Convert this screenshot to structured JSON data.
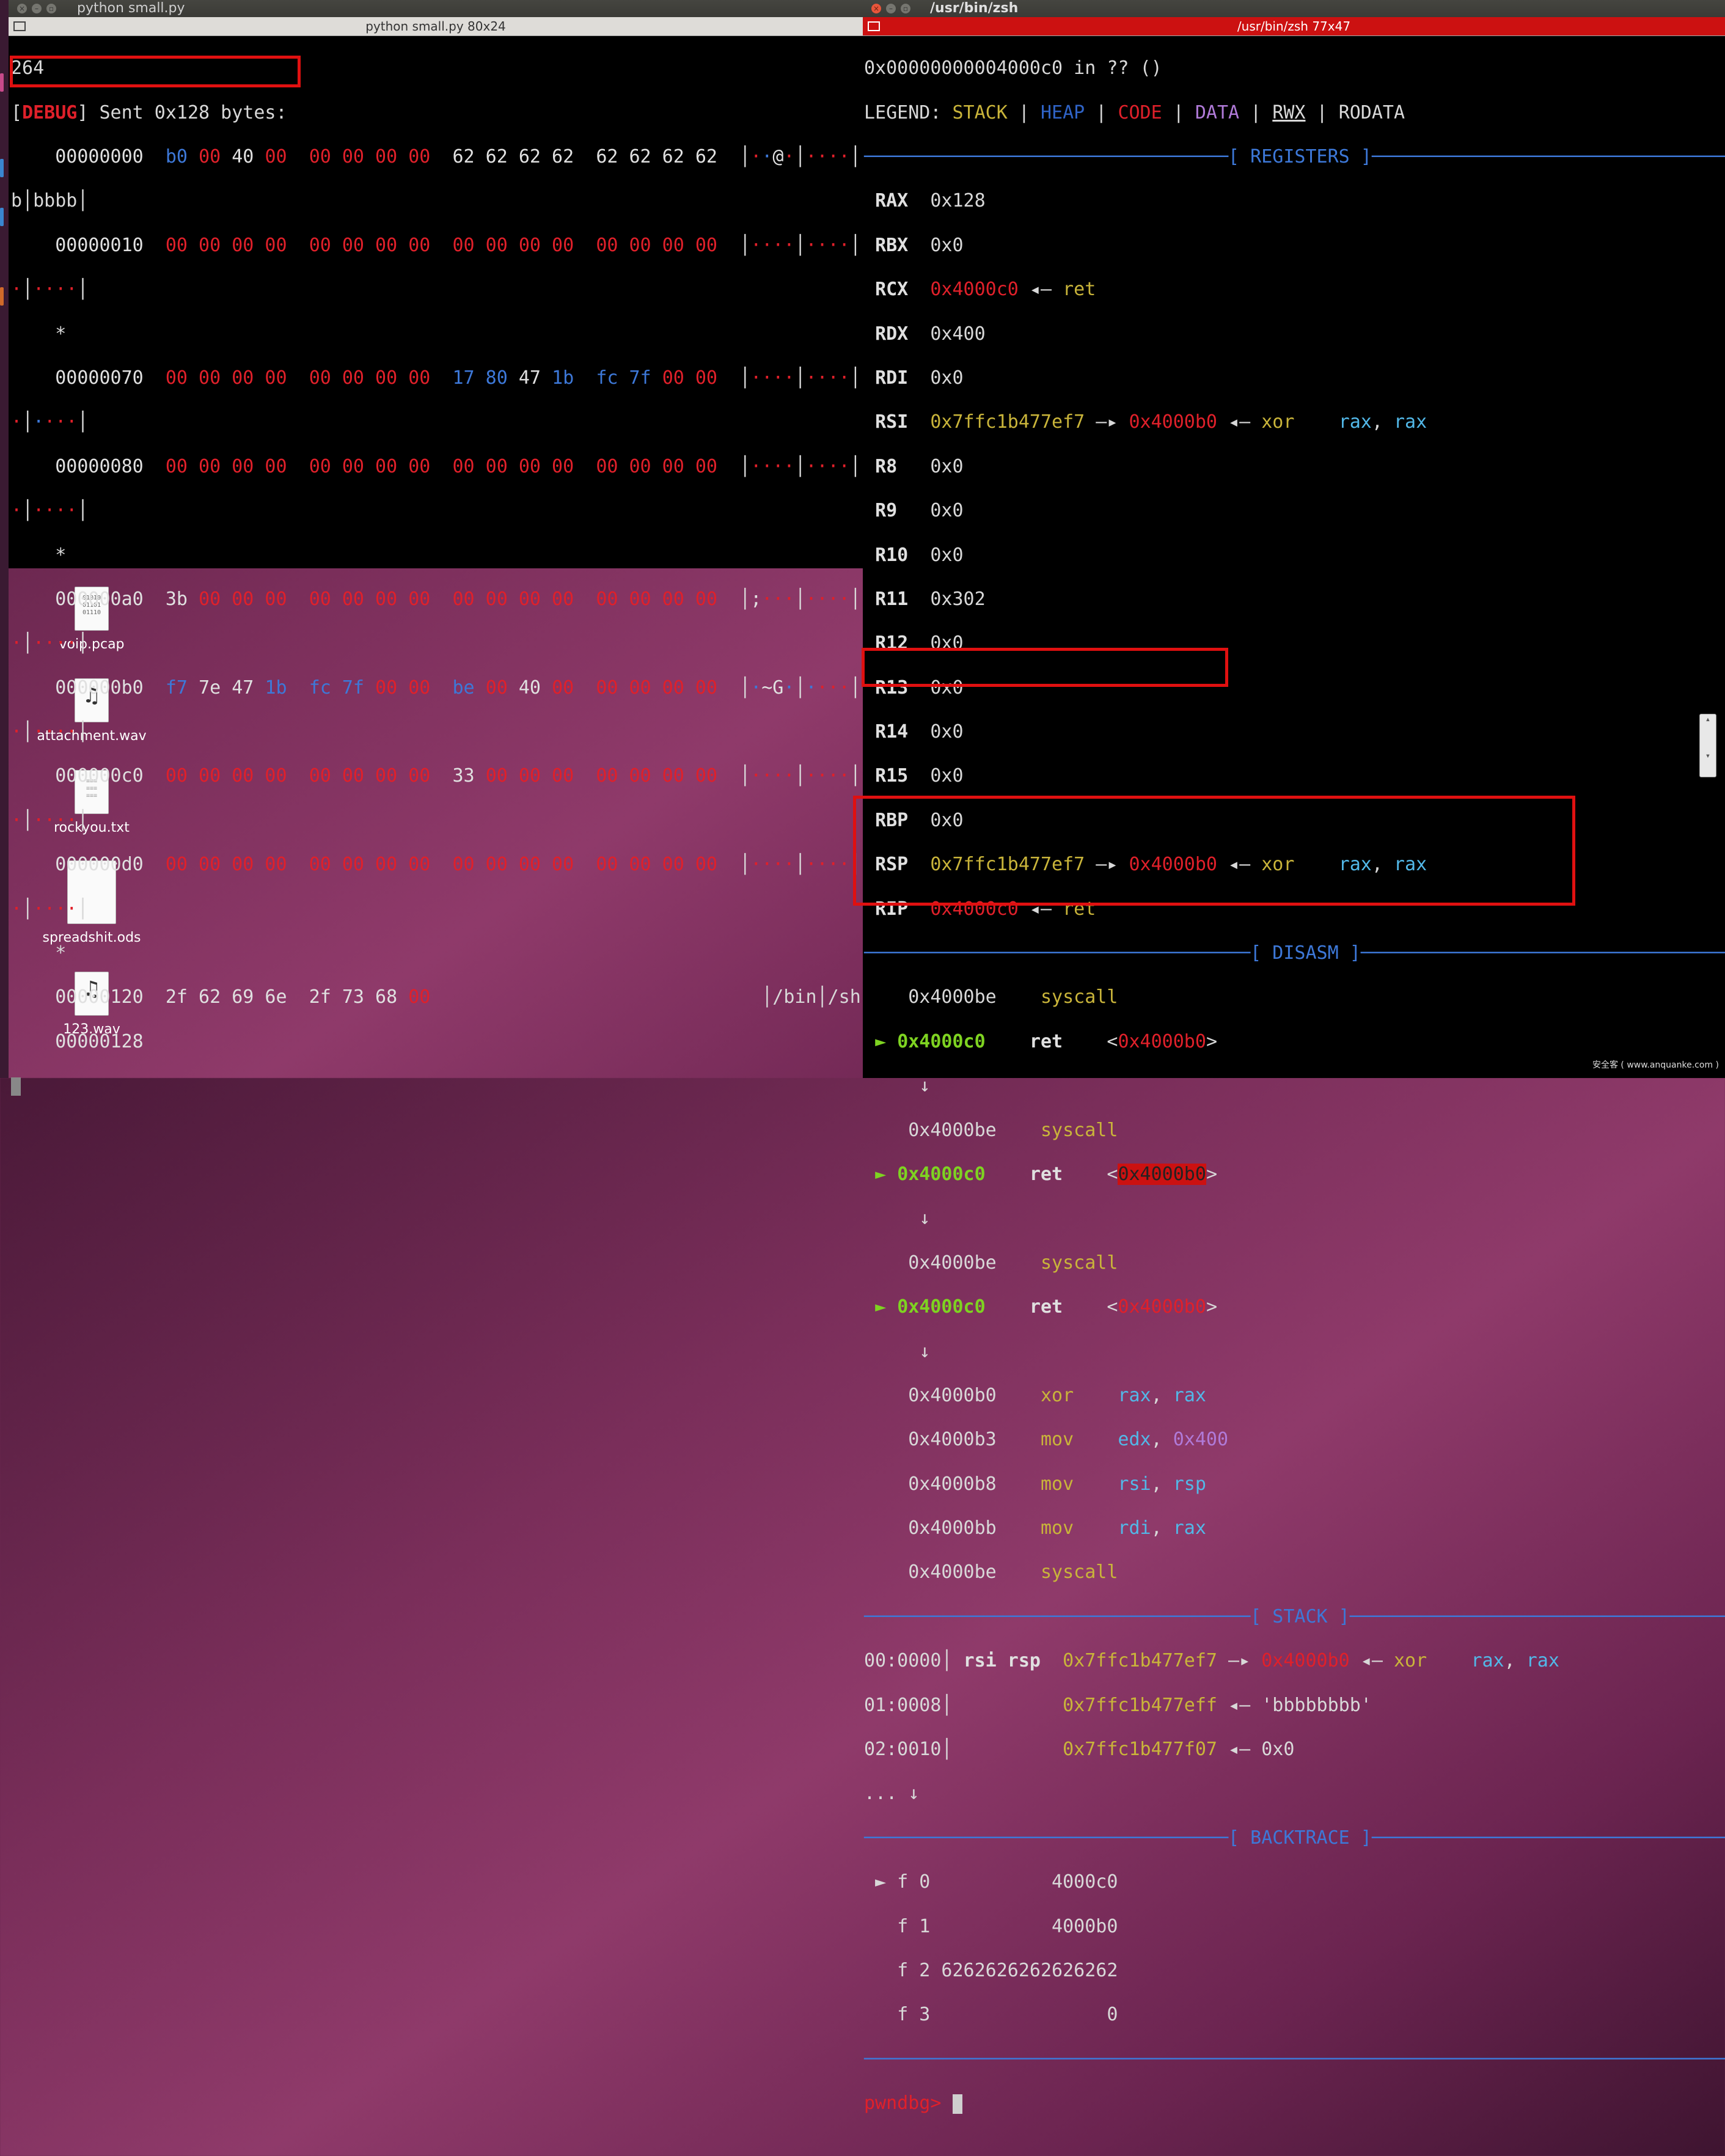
{
  "left_window": {
    "title": "python small.py",
    "subtitle": "python small.py 80x24",
    "first_line": "264",
    "debug_tag": "DEBUG",
    "debug_msg": "Sent 0x128 bytes:"
  },
  "right_window": {
    "title": "/usr/bin/zsh",
    "subtitle": "/usr/bin/zsh 77x47",
    "first_line": "0x00000000004000c0 in ?? ()",
    "legend": {
      "label": "LEGEND:",
      "stack": "STACK",
      "heap": "HEAP",
      "code": "CODE",
      "data": "DATA",
      "rwx": "RWX",
      "rodata": "RODATA"
    },
    "sections": {
      "registers": "[ REGISTERS ]",
      "disasm": "[ DISASM ]",
      "stack": "[ STACK ]",
      "backtrace": "[ BACKTRACE ]"
    },
    "prompt": "pwndbg>"
  },
  "colors": {
    "red": "#e0202a",
    "blue": "#3d78d8",
    "yellow": "#c9b43a",
    "green": "#7ed321",
    "cyan": "#52b8e8",
    "highlight": "#e01010"
  },
  "desktop_icons": [
    {
      "label": "voip.pcap",
      "icon": "binary-file-icon"
    },
    {
      "label": "attachment.wav",
      "icon": "audio-file-icon"
    },
    {
      "label": "rockyou.txt",
      "icon": "text-file-icon"
    },
    {
      "label": "spreadshit.ods",
      "icon": "spreadsheet-file-icon"
    },
    {
      "label": "123.wav",
      "icon": "audio-file-icon"
    }
  ],
  "watermark": "安全客 ( www.anquanke.com )"
}
